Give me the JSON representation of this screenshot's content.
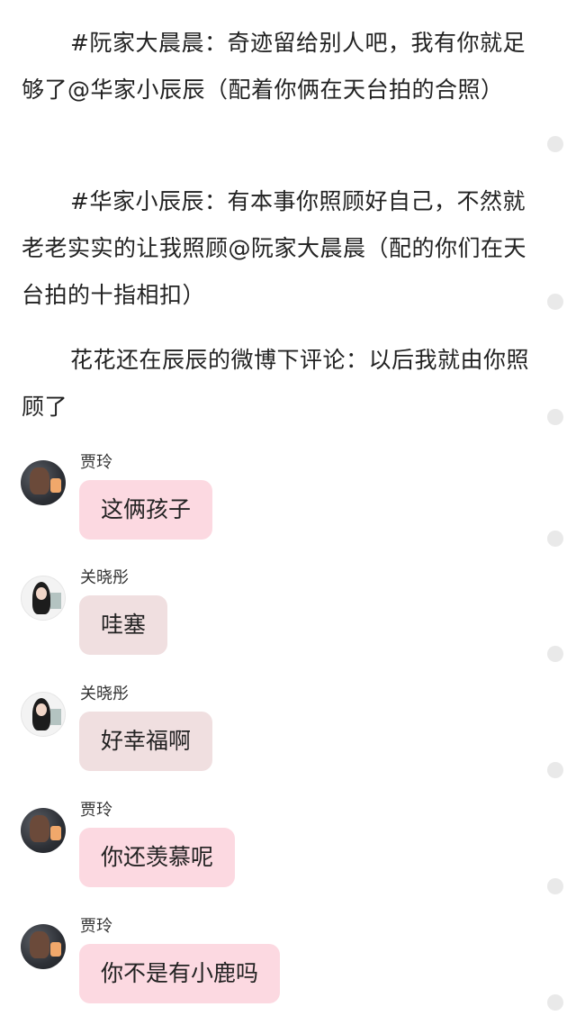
{
  "paragraphs": [
    "#阮家大晨晨：奇迹留给别人吧，我有你就足够了@华家小辰辰（配着你俩在天台拍的合照）",
    "#华家小辰辰：有本事你照顾好自己，不然就老老实实的让我照顾@阮家大晨晨（配的你们在天台拍的十指相扣）",
    "花花还在辰辰的微博下评论：以后我就由你照顾了"
  ],
  "comments": [
    {
      "name": "贾玲",
      "text": "这俩孩子",
      "avatar": "dark-avatar"
    },
    {
      "name": "关晓彤",
      "text": "哇塞",
      "avatar": "light-avatar"
    },
    {
      "name": "关晓彤",
      "text": "好幸福啊",
      "avatar": "light-avatar"
    },
    {
      "name": "贾玲",
      "text": "你还羡慕呢",
      "avatar": "dark-avatar"
    },
    {
      "name": "贾玲",
      "text": "你不是有小鹿吗",
      "avatar": "dark-avatar"
    }
  ],
  "colors": {
    "bubble_pink": "#fcd9e1",
    "bubble_beige": "#f0dfe0",
    "scroll_dot": "#e9e9e9",
    "text": "#222222"
  }
}
